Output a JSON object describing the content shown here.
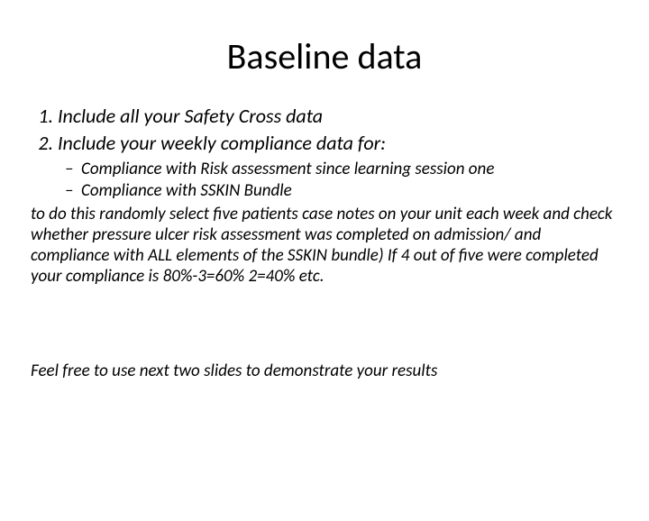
{
  "title": "Baseline data",
  "list1": {
    "item1": "Include all your Safety Cross data",
    "item2": "Include your weekly compliance data for:"
  },
  "list2": {
    "item1": "Compliance with Risk assessment since learning session one",
    "item2": "Compliance with SSKIN Bundle"
  },
  "paragraph": "to do this randomly select five patients case notes on your unit each week and check whether pressure ulcer risk assessment was completed on admission/ and compliance with ALL elements of the SSKIN bundle) If 4 out of five were completed your compliance is 80%-3=60% 2=40% etc.",
  "closing": "Feel free to use next two slides to demonstrate your results"
}
